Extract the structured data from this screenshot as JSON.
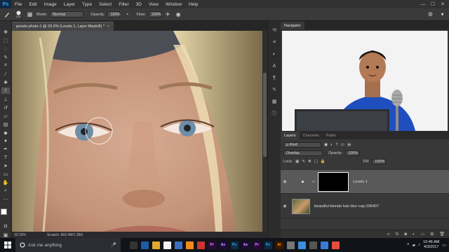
{
  "app": {
    "logo": "Ps"
  },
  "menu": [
    "File",
    "Edit",
    "Image",
    "Layer",
    "Type",
    "Select",
    "Filter",
    "3D",
    "View",
    "Window",
    "Help"
  ],
  "window_controls": [
    "—",
    "☐",
    "✕"
  ],
  "options": {
    "brush_size": "125",
    "mode_label": "Mode:",
    "mode_value": "Normal",
    "opacity_label": "Opacity:",
    "opacity_value": "100%",
    "flow_label": "Flow:",
    "flow_value": "100%"
  },
  "document": {
    "tab_title": "pexels-photo-1 @ 33.3% (Levels 1, Layer Mask/8) *",
    "close": "×",
    "zoom": "33.33%",
    "status": "Scratch: 803.4M/1.38G"
  },
  "navigator": {
    "title": "Navigator"
  },
  "layers_panel": {
    "tabs": [
      "Layers",
      "Channels",
      "Paths"
    ],
    "filter_label": "ρ Kind",
    "blend_mode": "Overlay",
    "opacity_label": "Opacity:",
    "opacity_value": "100%",
    "lock_label": "Lock:",
    "fill_label": "Fill:",
    "fill_value": "100%",
    "layers": [
      {
        "name": "Levels 1"
      },
      {
        "name": "beautiful-blonde-hair-blur-cap-206407"
      }
    ]
  },
  "taskbar": {
    "search_placeholder": "Ask me anything",
    "apps": [
      {
        "label": "",
        "bg": "#333",
        "fg": "#ddd"
      },
      {
        "label": "",
        "bg": "#1e5aa8",
        "fg": "#fff"
      },
      {
        "label": "",
        "bg": "#e0a82e",
        "fg": "#fff"
      },
      {
        "label": "",
        "bg": "#f2f2f2",
        "fg": "#e33"
      },
      {
        "label": "",
        "bg": "#3a6fc4",
        "fg": "#fff"
      },
      {
        "label": "",
        "bg": "#f08a1c",
        "fg": "#fff"
      },
      {
        "label": "",
        "bg": "#c33",
        "fg": "#fff"
      },
      {
        "label": "Pr",
        "bg": "#2a0a3d",
        "fg": "#e48cff"
      },
      {
        "label": "Ae",
        "bg": "#1f0a3d",
        "fg": "#c9a3ff"
      },
      {
        "label": "Ps",
        "bg": "#0f2b46",
        "fg": "#31a8ff"
      },
      {
        "label": "Ae",
        "bg": "#1f0a3d",
        "fg": "#c9a3ff"
      },
      {
        "label": "Pr",
        "bg": "#2a0a3d",
        "fg": "#e48cff"
      },
      {
        "label": "Ps",
        "bg": "#0f2b46",
        "fg": "#31a8ff"
      },
      {
        "label": "Ai",
        "bg": "#3a1a00",
        "fg": "#ff9a00"
      },
      {
        "label": "",
        "bg": "#777",
        "fg": "#fff"
      },
      {
        "label": "",
        "bg": "#3b8de0",
        "fg": "#fff"
      },
      {
        "label": "",
        "bg": "#555",
        "fg": "#fff"
      },
      {
        "label": "",
        "bg": "#3b7ad9",
        "fg": "#fff"
      },
      {
        "label": "",
        "bg": "#e84c3d",
        "fg": "#fff"
      }
    ],
    "time": "10:46 AM",
    "date": "4/3/2017"
  }
}
